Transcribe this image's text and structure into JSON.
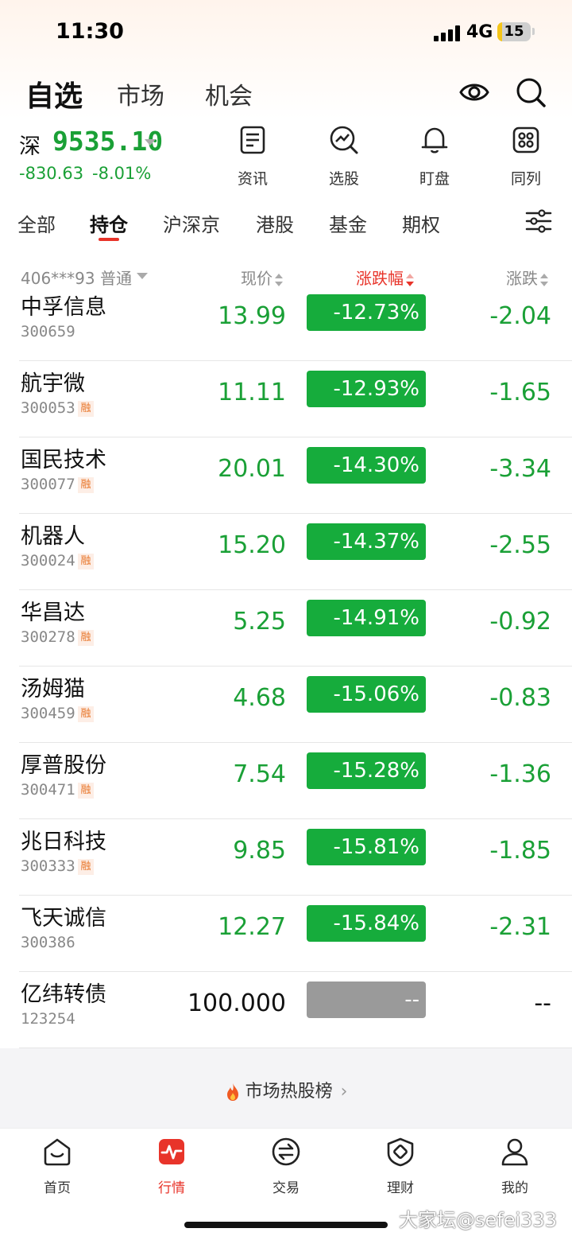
{
  "status_bar": {
    "time": "11:30",
    "network": "4G",
    "battery": "15",
    "battery_level": 0.15
  },
  "top_tabs": [
    {
      "label": "自选",
      "active": true
    },
    {
      "label": "市场",
      "active": false
    },
    {
      "label": "机会",
      "active": false
    }
  ],
  "top_icons": [
    "eye-icon",
    "search-icon"
  ],
  "index": {
    "name": "深",
    "value": "9535.10",
    "change": "-830.63",
    "pct": "-8.01%",
    "color": "#1aa036"
  },
  "quick_links": [
    {
      "label": "资讯",
      "icon": "news-icon"
    },
    {
      "label": "选股",
      "icon": "stock-picker-icon"
    },
    {
      "label": "盯盘",
      "icon": "bell-icon"
    },
    {
      "label": "同列",
      "icon": "grid-icon"
    }
  ],
  "filter_tabs": [
    {
      "label": "全部",
      "active": false
    },
    {
      "label": "持仓",
      "active": true
    },
    {
      "label": "沪深京",
      "active": false
    },
    {
      "label": "港股",
      "active": false
    },
    {
      "label": "基金",
      "active": false
    },
    {
      "label": "期权",
      "active": false
    }
  ],
  "table": {
    "account": "406***93 普通",
    "columns": {
      "price": "现价",
      "pct": "涨跌幅",
      "change": "涨跌"
    },
    "sorted_column": "pct",
    "margin_tag": "融",
    "rows": [
      {
        "name": "中孚信息",
        "code": "300659",
        "margin": false,
        "price": "13.99",
        "pct": "-12.73%",
        "change": "-2.04",
        "neutral": false
      },
      {
        "name": "航宇微",
        "code": "300053",
        "margin": true,
        "price": "11.11",
        "pct": "-12.93%",
        "change": "-1.65",
        "neutral": false
      },
      {
        "name": "国民技术",
        "code": "300077",
        "margin": true,
        "price": "20.01",
        "pct": "-14.30%",
        "change": "-3.34",
        "neutral": false
      },
      {
        "name": "机器人",
        "code": "300024",
        "margin": true,
        "price": "15.20",
        "pct": "-14.37%",
        "change": "-2.55",
        "neutral": false
      },
      {
        "name": "华昌达",
        "code": "300278",
        "margin": true,
        "price": "5.25",
        "pct": "-14.91%",
        "change": "-0.92",
        "neutral": false
      },
      {
        "name": "汤姆猫",
        "code": "300459",
        "margin": true,
        "price": "4.68",
        "pct": "-15.06%",
        "change": "-0.83",
        "neutral": false
      },
      {
        "name": "厚普股份",
        "code": "300471",
        "margin": true,
        "price": "7.54",
        "pct": "-15.28%",
        "change": "-1.36",
        "neutral": false
      },
      {
        "name": "兆日科技",
        "code": "300333",
        "margin": true,
        "price": "9.85",
        "pct": "-15.81%",
        "change": "-1.85",
        "neutral": false
      },
      {
        "name": "飞天诚信",
        "code": "300386",
        "margin": false,
        "price": "12.27",
        "pct": "-15.84%",
        "change": "-2.31",
        "neutral": false
      },
      {
        "name": "亿纬转债",
        "code": "123254",
        "margin": false,
        "price": "100.000",
        "pct": "--",
        "change": "--",
        "neutral": true
      }
    ]
  },
  "hot_list": {
    "label": "市场热股榜",
    "icon": "flame-icon"
  },
  "bottom_nav": [
    {
      "label": "首页",
      "icon": "home-icon",
      "active": false
    },
    {
      "label": "行情",
      "icon": "market-icon",
      "active": true
    },
    {
      "label": "交易",
      "icon": "trade-icon",
      "active": false
    },
    {
      "label": "理财",
      "icon": "wealth-icon",
      "active": false
    },
    {
      "label": "我的",
      "icon": "profile-icon",
      "active": false
    }
  ],
  "watermark": "大家坛@sefei333",
  "colors": {
    "down_green": "#1aa036",
    "pct_green": "#16ac3c",
    "accent_red": "#e8342a",
    "neutral_gray": "#9a9a9a"
  }
}
